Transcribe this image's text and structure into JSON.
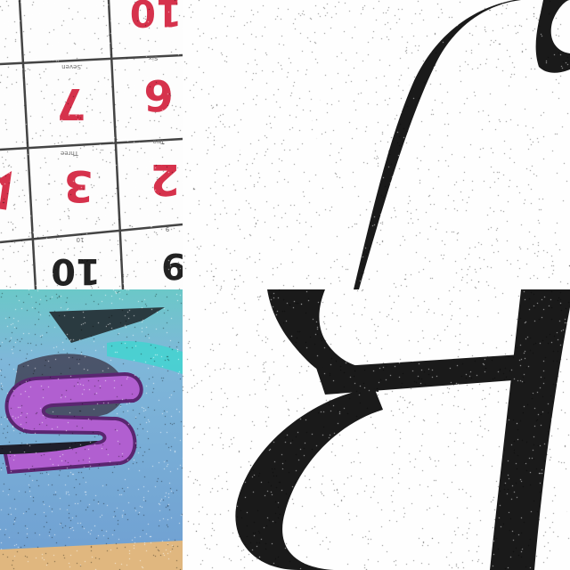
{
  "mosaic": {
    "tiles": [
      {
        "name": "number-cards",
        "description_free": true
      },
      {
        "name": "script-glyph-top"
      },
      {
        "name": "purple-s-logo"
      },
      {
        "name": "script-glyph-bottom"
      }
    ]
  },
  "number_cards": {
    "numbers": [
      "10",
      "7",
      "6",
      "3",
      "2",
      "10",
      "9"
    ],
    "words": [
      "Seven",
      "Six",
      "Three",
      "Two",
      "10",
      "9"
    ],
    "number_color": "#d6324c",
    "grid_color": "#444444"
  },
  "logo": {
    "letter": "S",
    "letter_color": "#b15fd0",
    "background_color": "#7fb2d6",
    "accent_color": "#3fd6d0"
  },
  "glyph": {
    "ink_color": "#1a1a1a"
  }
}
